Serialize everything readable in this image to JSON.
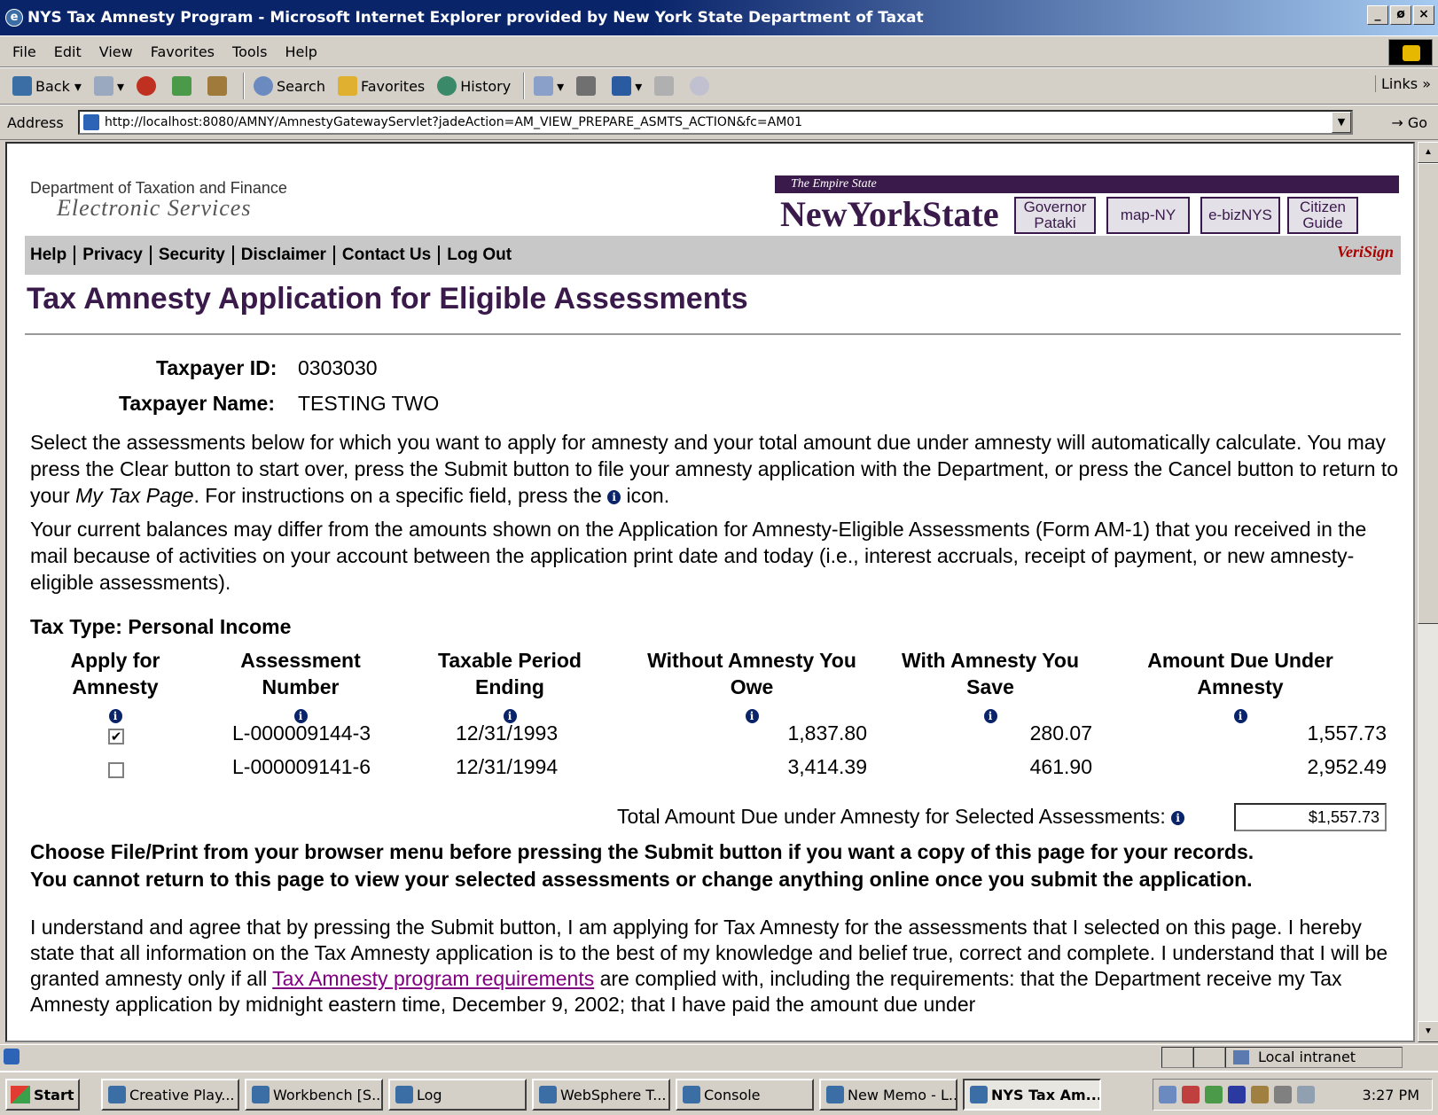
{
  "window": {
    "title": "NYS Tax Amnesty Program - Microsoft Internet Explorer provided by New York State Department of Taxat",
    "controls": [
      "_",
      "ø",
      "×"
    ]
  },
  "menu": [
    "File",
    "Edit",
    "View",
    "Favorites",
    "Tools",
    "Help"
  ],
  "toolbar": {
    "back": "Back",
    "search": "Search",
    "favorites": "Favorites",
    "history": "History",
    "links": "Links"
  },
  "address": {
    "label": "Address",
    "url": "http://localhost:8080/AMNY/AmnestyGatewayServlet?jadeAction=AM_VIEW_PREPARE_ASMTS_ACTION&fc=AM01",
    "go": "Go"
  },
  "header": {
    "dept": "Department of Taxation and Finance",
    "eservices": "Electronic Services",
    "empire": "The Empire State",
    "nys": "NewYorkState",
    "buttons": {
      "governor": "Governor Pataki",
      "mapny": "map-NY",
      "ebiz": "e-bizNYS",
      "citizen": "Citizen Guide"
    },
    "verisign": "VeriSign"
  },
  "nav": {
    "help": "Help",
    "privacy": "Privacy",
    "security": "Security",
    "disclaimer": "Disclaimer",
    "contact": "Contact Us",
    "logout": "Log Out"
  },
  "page": {
    "title": "Tax Amnesty Application for Eligible Assessments",
    "taxpayer_id_label": "Taxpayer ID:",
    "taxpayer_id": "0303030",
    "taxpayer_name_label": "Taxpayer Name:",
    "taxpayer_name": "TESTING TWO",
    "instr_1a": "Select the assessments below for which you want to apply for amnesty and your total amount due under amnesty will automatically calculate. You may press the Clear button to start over, press the Submit button to file your amnesty application with the Department, or press the Cancel button to return to your ",
    "instr_1b": "My Tax Page",
    "instr_1c": ".  For instructions on a specific field, press the ",
    "instr_1d": " icon.",
    "instr_2": "Your current balances may differ from the amounts shown on the Application for Amnesty-Eligible Assessments (Form AM-1) that you received in the mail because of activities on your account between the application print date and today (i.e., interest accruals, receipt of payment, or new amnesty-eligible assessments).",
    "tax_type": "Tax Type: Personal Income",
    "columns": {
      "apply": "Apply for Amnesty",
      "assessment": "Assessment Number",
      "period": "Taxable Period Ending",
      "without": "Without Amnesty You Owe",
      "save": "With Amnesty You Save",
      "due": "Amount Due Under Amnesty"
    },
    "rows": [
      {
        "checked": "✔",
        "assessment": "L-000009144-3",
        "period": "12/31/1993",
        "without": "1,837.80",
        "save": "280.07",
        "due": "1,557.73"
      },
      {
        "checked": "",
        "assessment": "L-000009141-6",
        "period": "12/31/1994",
        "without": "3,414.39",
        "save": "461.90",
        "due": "2,952.49"
      }
    ],
    "total_label": "Total Amount Due under Amnesty for Selected Assessments:",
    "total_value": "$1,557.73",
    "warning_1": "Choose File/Print from your browser menu before pressing the Submit button if you want a copy of this page for your records.",
    "warning_2": "You cannot return to this page to view your selected assessments or change anything online once you submit the application.",
    "agree_a": " I understand and agree that by pressing the Submit button, I am applying for Tax Amnesty for the assessments that I selected on this page. I hereby state that all information on the Tax Amnesty application is to the best of my knowledge and belief true, correct and complete. I understand that I will be granted amnesty only if all ",
    "agree_link": "Tax Amnesty program requirements",
    "agree_b": " are complied with, including the requirements: that the Department receive my Tax Amnesty application by midnight eastern time, December 9, 2002; that I have paid the amount due under"
  },
  "status": {
    "zone": "Local intranet"
  },
  "taskbar": {
    "start": "Start",
    "tasks": [
      "Creative Play...",
      "Workbench [S...",
      "Log",
      "WebSphere T...",
      "Console",
      "New Memo - L...",
      "NYS Tax Am..."
    ],
    "clock": "3:27 PM"
  }
}
